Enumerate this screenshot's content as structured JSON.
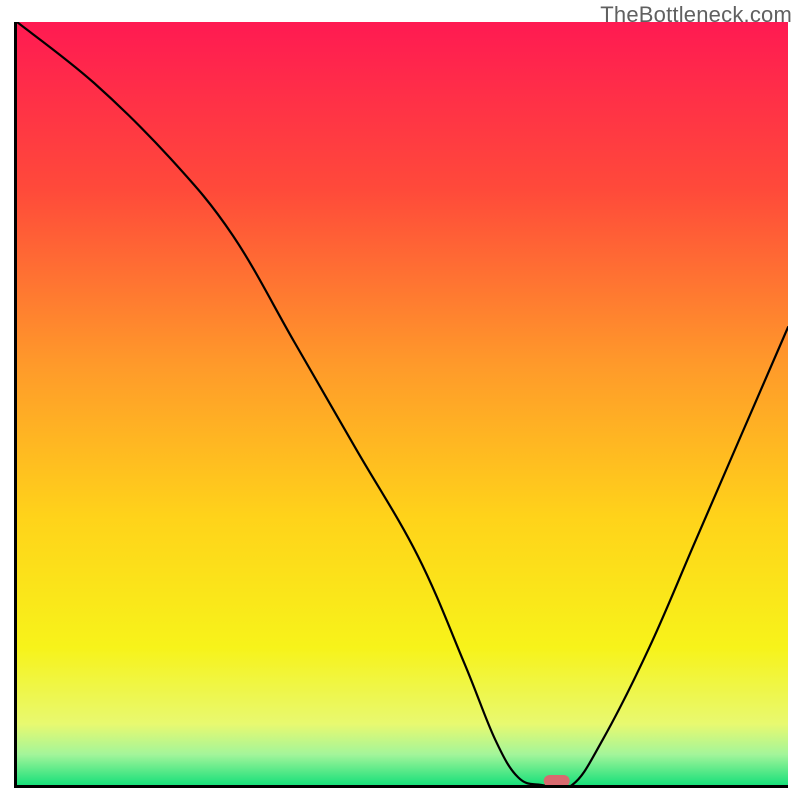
{
  "watermark": "TheBottleneck.com",
  "chart_data": {
    "type": "line",
    "title": "",
    "xlabel": "",
    "ylabel": "",
    "x_range": [
      0,
      100
    ],
    "y_range": [
      0,
      100
    ],
    "series": [
      {
        "name": "bottleneck-curve",
        "x": [
          0,
          10,
          20,
          28,
          36,
          44,
          52,
          58,
          62,
          65,
          68,
          72,
          76,
          82,
          88,
          94,
          100
        ],
        "values": [
          100,
          92,
          82,
          72,
          58,
          44,
          30,
          16,
          6,
          1,
          0,
          0,
          6,
          18,
          32,
          46,
          60
        ]
      }
    ],
    "annotations": [
      {
        "name": "optimal-marker",
        "type": "pill",
        "x": 70,
        "y": 0,
        "color": "#d86a6f"
      }
    ],
    "background_gradient": {
      "stops": [
        {
          "y": 100,
          "color": "#ff1a52"
        },
        {
          "y": 78,
          "color": "#ff4a3a"
        },
        {
          "y": 55,
          "color": "#ff9a2a"
        },
        {
          "y": 35,
          "color": "#ffd31a"
        },
        {
          "y": 18,
          "color": "#f7f31a"
        },
        {
          "y": 8,
          "color": "#e8f970"
        },
        {
          "y": 4,
          "color": "#a3f59a"
        },
        {
          "y": 0,
          "color": "#18e07a"
        }
      ]
    }
  }
}
